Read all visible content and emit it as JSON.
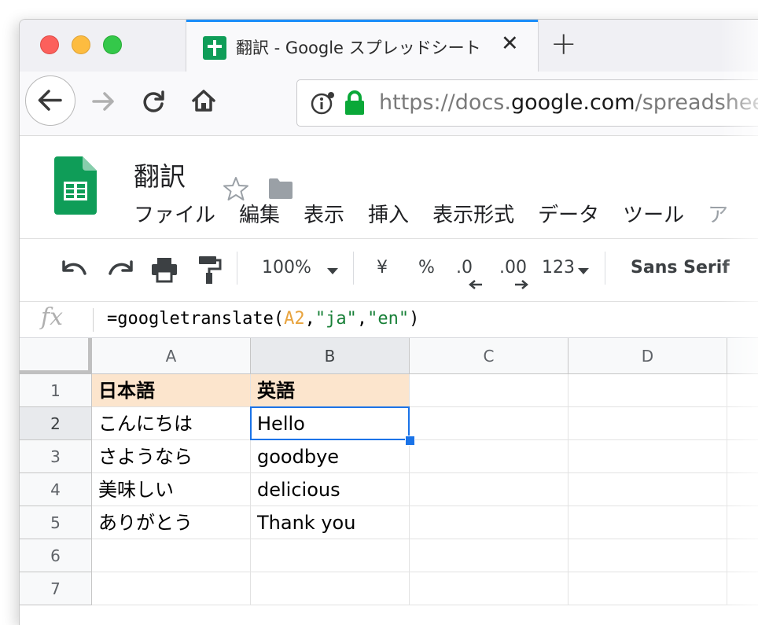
{
  "browser": {
    "tab_title": "翻訳 - Google スプレッドシート",
    "tab_close": "✕",
    "new_tab": "+",
    "url_prefix": "https://docs.",
    "url_domain": "google.com",
    "url_rest": "/spreadsheets"
  },
  "sheets": {
    "doc_title": "翻訳",
    "menu": [
      "ファイル",
      "編集",
      "表示",
      "挿入",
      "表示形式",
      "データ",
      "ツール",
      "ア"
    ]
  },
  "toolbar": {
    "zoom": "100%",
    "currency": "¥",
    "percent": "%",
    "decimal_decrease": ".0",
    "decimal_increase": ".00",
    "number_format": "123",
    "font": "Sans Serif"
  },
  "formula_bar": {
    "fx": "fx",
    "parts": [
      {
        "text": "=googletranslate(",
        "color": "#000000"
      },
      {
        "text": "A2",
        "color": "#e8a33d"
      },
      {
        "text": ",",
        "color": "#000000"
      },
      {
        "text": "\"ja\"",
        "color": "#188038"
      },
      {
        "text": ",",
        "color": "#000000"
      },
      {
        "text": "\"en\"",
        "color": "#188038"
      },
      {
        "text": ")",
        "color": "#000000"
      }
    ]
  },
  "grid": {
    "columns": [
      "A",
      "B",
      "C",
      "D"
    ],
    "rows": [
      "1",
      "2",
      "3",
      "4",
      "5",
      "6",
      "7"
    ],
    "cells": [
      [
        "日本語",
        "英語",
        "",
        ""
      ],
      [
        "こんにちは",
        "Hello",
        "",
        ""
      ],
      [
        "さようなら",
        "goodbye",
        "",
        ""
      ],
      [
        "美味しい",
        "delicious",
        "",
        ""
      ],
      [
        "ありがとう",
        "Thank you",
        "",
        ""
      ],
      [
        "",
        "",
        "",
        ""
      ],
      [
        "",
        "",
        "",
        ""
      ]
    ],
    "active_cell": "B2",
    "header_fill": "#fce5cd"
  },
  "colors": {
    "sheets_green": "#0f9d58",
    "selection_blue": "#1a73e8",
    "tab_accent": "#1c8ef9",
    "secure_lock": "#0aa838"
  }
}
